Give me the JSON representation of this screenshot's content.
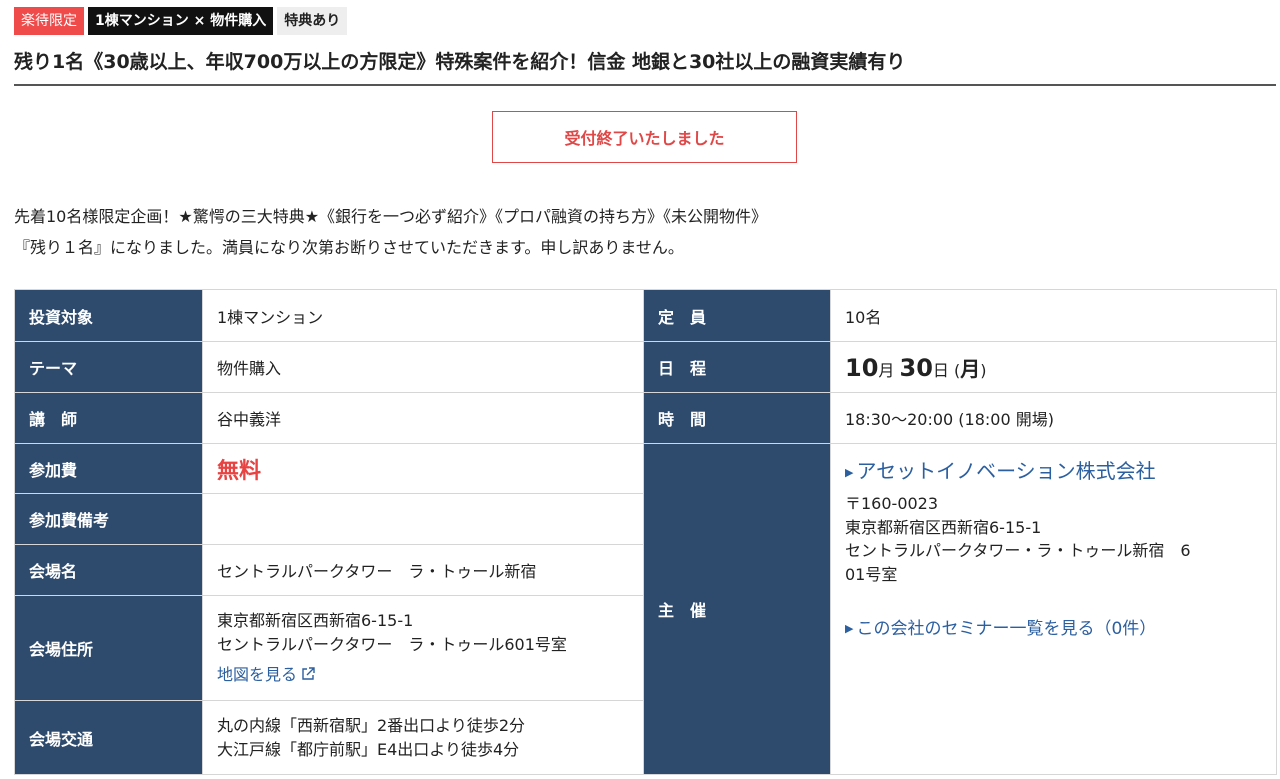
{
  "tags": [
    "楽待限定",
    "1棟マンション × 物件購入",
    "特典あり"
  ],
  "title": "残り1名《30歳以上、年収700万以上の方限定》特殊案件を紹介！信金 地銀と30社以上の融資実績有り",
  "status_button": "受付終了いたしました",
  "description": {
    "line1": "先着10名様限定企画！★驚愕の三大特典★《銀行を一つ必ず紹介》《プロパ融資の持ち方》《未公開物件》",
    "line2": "『残り１名』になりました。満員になり次第お断りさせていただきます。申し訳ありません。"
  },
  "info": {
    "investment_label": "投資対象",
    "investment_value": "1棟マンション",
    "theme_label": "テーマ",
    "theme_value": "物件購入",
    "lecturer_label": "講　師",
    "lecturer_value": "谷中義洋",
    "fee_label": "参加費",
    "fee_value": "無料",
    "fee_note_label": "参加費備考",
    "fee_note_value": "",
    "venue_label": "会場名",
    "venue_value": "セントラルパークタワー　ラ・トゥール新宿",
    "address_label": "会場住所",
    "address_line1": "東京都新宿区西新宿6-15-1",
    "address_line2": "セントラルパークタワー　ラ・トゥール601号室",
    "map_link": "地図を見る",
    "access_label": "会場交通",
    "access_line1": "丸の内線「西新宿駅」2番出口より徒歩2分",
    "access_line2": "大江戸線「都庁前駅」E4出口より徒歩4分",
    "capacity_label": "定　員",
    "capacity_value": "10名",
    "schedule_label": "日　程",
    "schedule_month": "10",
    "schedule_month_unit": "月",
    "schedule_day": "30",
    "schedule_day_unit": "日",
    "schedule_weekday": "月",
    "time_label": "時　間",
    "time_value": "18:30〜20:00 (18:00 開場)",
    "organizer_label": "主　催",
    "organizer_name": "アセットイノベーション株式会社",
    "organizer_zip": "〒160-0023",
    "organizer_addr1": "東京都新宿区西新宿6-15-1",
    "organizer_addr2": "セントラルパークタワー・ラ・トゥール新宿　6",
    "organizer_addr3": "01号室",
    "organizer_seminars_link": "この会社のセミナー一覧を見る（0件）"
  },
  "colors": {
    "header_cell_bg": "#2e4b6e",
    "accent_red": "#e84343",
    "link_blue": "#2b5fa0"
  }
}
